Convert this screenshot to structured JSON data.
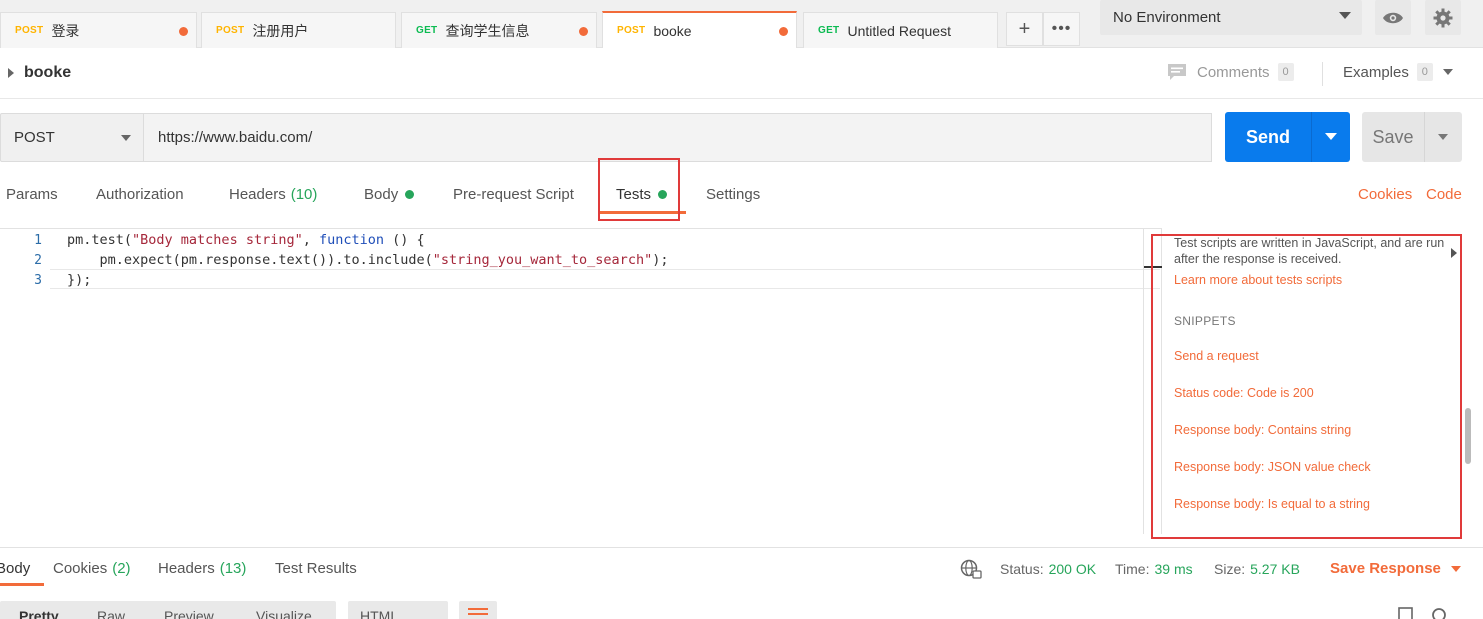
{
  "tabs": [
    {
      "method": "POST",
      "name": "登录",
      "modified": true
    },
    {
      "method": "POST",
      "name": "注册用户",
      "modified": false
    },
    {
      "method": "GET",
      "name": "查询学生信息",
      "modified": true
    },
    {
      "method": "POST",
      "name": "booke",
      "modified": true,
      "active": true
    },
    {
      "method": "GET",
      "name": "Untitled Request",
      "modified": false
    }
  ],
  "environment": {
    "selected": "No Environment"
  },
  "request": {
    "name": "booke",
    "comments_label": "Comments",
    "comments_count": "0",
    "examples_label": "Examples",
    "examples_count": "0",
    "method": "POST",
    "url": "https://www.baidu.com/",
    "send_label": "Send",
    "save_label": "Save"
  },
  "request_tabs": {
    "params": "Params",
    "authorization": "Authorization",
    "headers": "Headers",
    "headers_count": "(10)",
    "body": "Body",
    "pre_request": "Pre-request Script",
    "tests": "Tests",
    "settings": "Settings",
    "cookies_link": "Cookies",
    "code_link": "Code"
  },
  "editor": {
    "lines": [
      "1",
      "2",
      "3"
    ],
    "line1_a": "pm.test(",
    "line1_str": "\"Body matches string\"",
    "line1_b": ", ",
    "line1_kw": "function",
    "line1_c": " () {",
    "line2_a": "    pm.expect(pm.response.text()).to.include(",
    "line2_str": "\"string_you_want_to_search\"",
    "line2_b": ");",
    "line3": "});"
  },
  "snippets_panel": {
    "description": "Test scripts are written in JavaScript, and are run after the response is received.",
    "learn_more": "Learn more about tests scripts",
    "heading": "SNIPPETS",
    "items": [
      "Send a request",
      "Status code: Code is 200",
      "Response body: Contains string",
      "Response body: JSON value check",
      "Response body: Is equal to a string"
    ]
  },
  "response": {
    "tabs": {
      "body": "Body",
      "cookies": "Cookies",
      "cookies_count": "(2)",
      "headers": "Headers",
      "headers_count": "(13)",
      "test_results": "Test Results"
    },
    "status_label": "Status:",
    "status_value": "200 OK",
    "time_label": "Time:",
    "time_value": "39 ms",
    "size_label": "Size:",
    "size_value": "5.27 KB",
    "save_response": "Save Response",
    "view_tabs": [
      "Pretty",
      "Raw",
      "Preview",
      "Visualize"
    ],
    "format": "HTML"
  },
  "colors": {
    "accent": "#f26b3a",
    "send": "#097bed",
    "success": "#27a55b",
    "highlight_box": "#e03a3a"
  }
}
